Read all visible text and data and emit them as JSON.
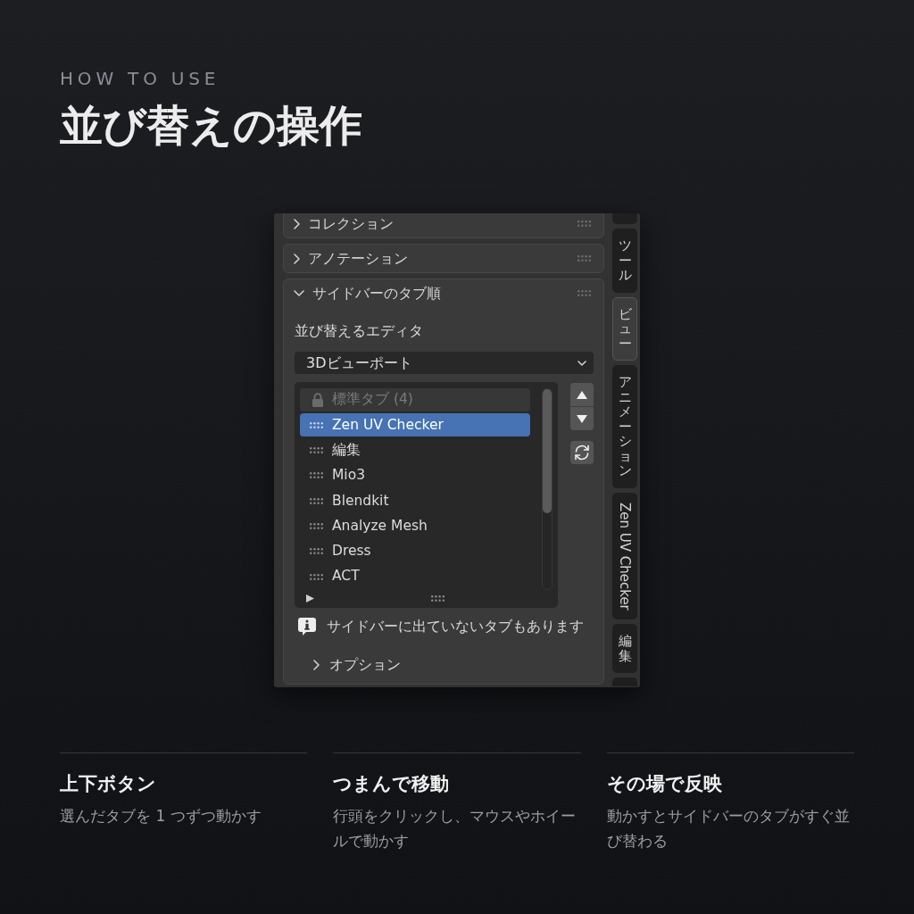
{
  "header": {
    "eyebrow": "HOW TO USE",
    "title": "並び替えの操作"
  },
  "panel": {
    "sections": [
      {
        "title": "コレクション",
        "expanded": false
      },
      {
        "title": "アノテーション",
        "expanded": false
      },
      {
        "title": "サイドバーのタブ順",
        "expanded": true,
        "content": {
          "editor_label": "並び替えるエディタ",
          "editor_select": {
            "value": "3Dビューポート"
          },
          "tab_list": {
            "items": [
              {
                "label": "標準タブ (4)",
                "kind": "locked",
                "selected": false
              },
              {
                "label": "Zen UV Checker",
                "kind": "tab",
                "selected": true
              },
              {
                "label": "編集",
                "kind": "tab",
                "selected": false
              },
              {
                "label": "Mio3",
                "kind": "tab",
                "selected": false
              },
              {
                "label": "Blendkit",
                "kind": "tab",
                "selected": false
              },
              {
                "label": "Analyze Mesh",
                "kind": "tab",
                "selected": false
              },
              {
                "label": "Dress",
                "kind": "tab",
                "selected": false
              },
              {
                "label": "ACT",
                "kind": "tab",
                "selected": false
              }
            ],
            "options_expanded": false
          },
          "notice": "サイドバーに出ていないタブもあります",
          "options": {
            "title": "オプション",
            "expanded": false
          }
        }
      }
    ],
    "side_tabs": [
      {
        "label": "ツール",
        "kind": "stacked",
        "selected": false
      },
      {
        "label": "ビュー",
        "kind": "stacked",
        "selected": true
      },
      {
        "label": "アニメーション",
        "kind": "stacked",
        "selected": false
      },
      {
        "label": "Zen UV Checker",
        "kind": "rotated",
        "selected": false
      },
      {
        "label": "編集",
        "kind": "stacked",
        "selected": false
      }
    ]
  },
  "features": [
    {
      "title": "上下ボタン",
      "text": "選んだタブを 1 つずつ動かす"
    },
    {
      "title": "つまんで移動",
      "text": "行頭をクリックし、マウスやホイールで動かす"
    },
    {
      "title": "その場で反映",
      "text": "動かすとサイドバーのタブがすぐ並び替わる"
    }
  ]
}
